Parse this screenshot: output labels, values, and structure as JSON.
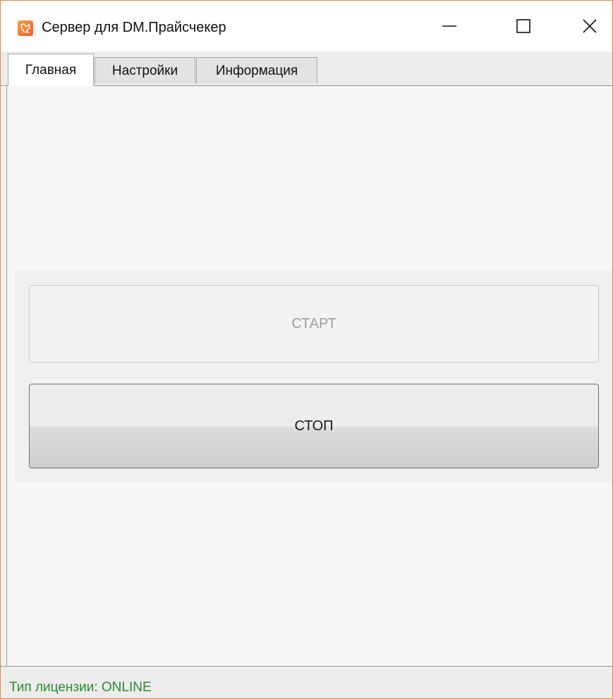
{
  "window": {
    "title": "Сервер для DM.Прайсчекер",
    "border_color": "#e8893a",
    "icons": {
      "app": "app-logo-icon",
      "minimize": "minimize-icon",
      "maximize": "maximize-icon",
      "close": "close-icon"
    }
  },
  "tabs": [
    {
      "label": "Главная",
      "active": true
    },
    {
      "label": "Настройки",
      "active": false
    },
    {
      "label": "Информация",
      "active": false
    }
  ],
  "main": {
    "start_label": "СТАРТ",
    "start_enabled": false,
    "stop_label": "СТОП",
    "stop_enabled": true
  },
  "status": {
    "text": "Тип лицензии: ONLINE",
    "color": "#2e8b2e"
  }
}
